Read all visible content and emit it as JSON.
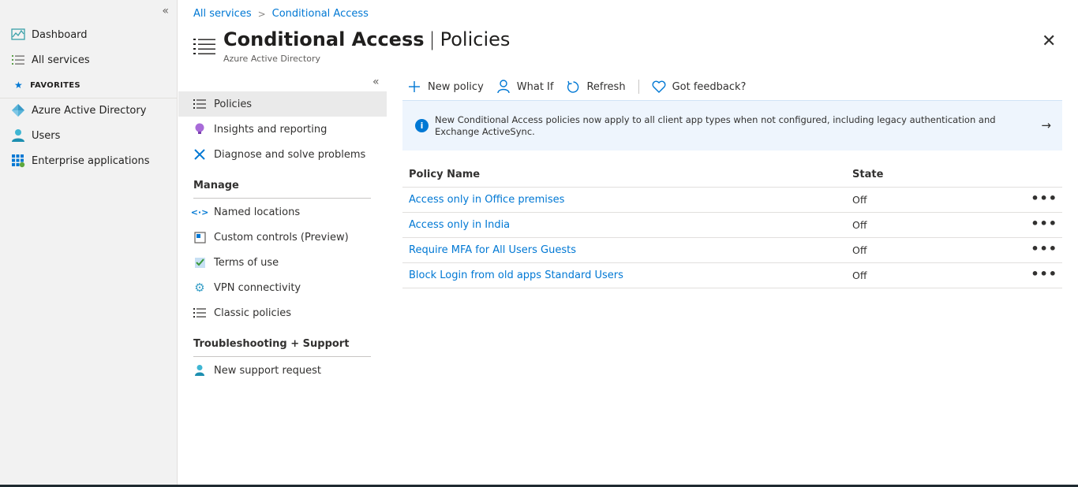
{
  "leftnav": {
    "collapse_icon": "«",
    "items": [
      {
        "label": "Dashboard",
        "icon": "dashboard-icon"
      },
      {
        "label": "All services",
        "icon": "list-icon"
      }
    ],
    "favorites_label": "FAVORITES",
    "favorites": [
      {
        "label": "Azure Active Directory",
        "icon": "azure-ad-icon"
      },
      {
        "label": "Users",
        "icon": "user-icon"
      },
      {
        "label": "Enterprise applications",
        "icon": "apps-grid-icon"
      }
    ]
  },
  "breadcrumb": {
    "items": [
      "All services",
      "Conditional Access"
    ],
    "separator": ">"
  },
  "header": {
    "title_main": "Conditional Access",
    "title_sep": "|",
    "title_page": "Policies",
    "subtitle": "Azure Active Directory",
    "close_icon": "✕"
  },
  "blade_menu": {
    "collapse_icon": "«",
    "items": [
      {
        "label": "Policies",
        "active": true
      },
      {
        "label": "Insights and reporting"
      },
      {
        "label": "Diagnose and solve problems"
      }
    ],
    "manage_label": "Manage",
    "manage_items": [
      {
        "label": "Named locations"
      },
      {
        "label": "Custom controls (Preview)"
      },
      {
        "label": "Terms of use"
      },
      {
        "label": "VPN connectivity"
      },
      {
        "label": "Classic policies"
      }
    ],
    "support_label": "Troubleshooting + Support",
    "support_items": [
      {
        "label": "New support request"
      }
    ]
  },
  "commandbar": {
    "new_policy": "New policy",
    "what_if": "What If",
    "refresh": "Refresh",
    "feedback": "Got feedback?"
  },
  "banner": {
    "text": "New Conditional Access policies now apply to all client app types when not configured, including legacy authentication and Exchange ActiveSync.",
    "arrow": "→"
  },
  "table": {
    "headers": [
      "Policy Name",
      "State"
    ],
    "rows": [
      {
        "name": "Access only in Office premises",
        "state": "Off"
      },
      {
        "name": "Access only in India",
        "state": "Off"
      },
      {
        "name": "Require MFA for All Users Guests",
        "state": "Off"
      },
      {
        "name": "Block Login from old apps Standard Users",
        "state": "Off"
      }
    ],
    "more_icon": "•••"
  },
  "colors": {
    "accent": "#0078d4",
    "nav_bg": "#f2f2f2",
    "banner_bg": "#eef5fd"
  }
}
